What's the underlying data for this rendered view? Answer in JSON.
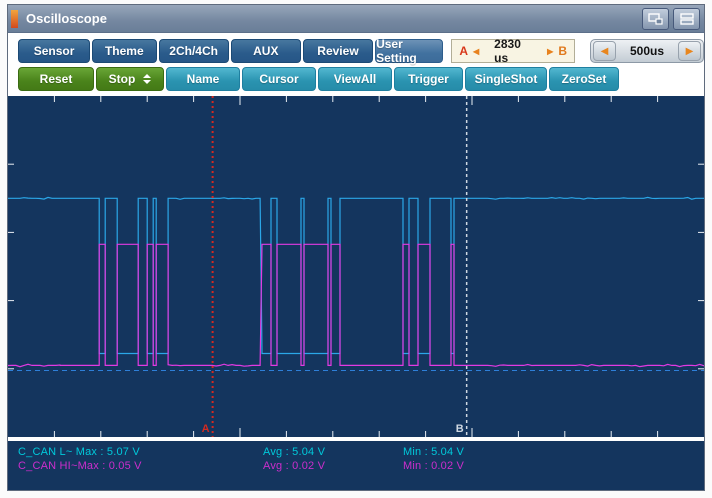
{
  "window": {
    "title": "Oscilloscope",
    "accent_color": "#e2641f",
    "controls": [
      {
        "name": "cascade-windows-icon"
      },
      {
        "name": "stacked-windows-icon"
      }
    ]
  },
  "toolbar_row1": {
    "buttons": [
      "Sensor",
      "Theme",
      "2Ch/4Ch",
      "AUX",
      "Review",
      "User Setting"
    ]
  },
  "ab_readout": {
    "a_label": "A",
    "left_arrow": "◀",
    "value": "2830 us",
    "right_arrow": "▶",
    "b_label": "B"
  },
  "timebase": {
    "left_arrow": "◀",
    "value": "500us",
    "right_arrow": "▶"
  },
  "toolbar_row2": {
    "buttons": [
      "Reset",
      "Stop",
      "Name",
      "Cursor",
      "ViewAll",
      "Trigger",
      "SingleShot",
      "ZeroSet"
    ]
  },
  "scope": {
    "background": "#14355e",
    "tick_color": "#e8eef4",
    "trace1": {
      "name": "C_CAN L",
      "color": "#2ba7e8",
      "high_frac": 0.3,
      "low_frac": 0.755
    },
    "trace2": {
      "name": "C_CAN HI",
      "color": "#e23ae2",
      "high_frac": 0.435,
      "low_frac": 0.79
    },
    "baseline": {
      "color": "#2e7fd8",
      "y_frac": 0.805
    },
    "bursts": [
      [
        0.075,
        0.23
      ],
      [
        0.365,
        0.672
      ]
    ],
    "cursors": [
      {
        "label": "A",
        "x_frac": 0.294,
        "color": "#d42a20",
        "dash": "2,3",
        "width": 2
      },
      {
        "label": "B",
        "x_frac": 0.659,
        "color": "#cfd8e2",
        "dash": "3,3",
        "width": 1.5
      }
    ]
  },
  "status": {
    "rows": [
      {
        "color": "#00c9da",
        "cells": [
          "C_CAN L~ Max : 5.07 V",
          "Avg : 5.04 V",
          "Min : 5.04 V"
        ]
      },
      {
        "color": "#cc2ecc",
        "cells": [
          "C_CAN HI~Max : 0.05 V",
          "Avg : 0.02 V",
          "Min : 0.02 V"
        ]
      }
    ]
  }
}
